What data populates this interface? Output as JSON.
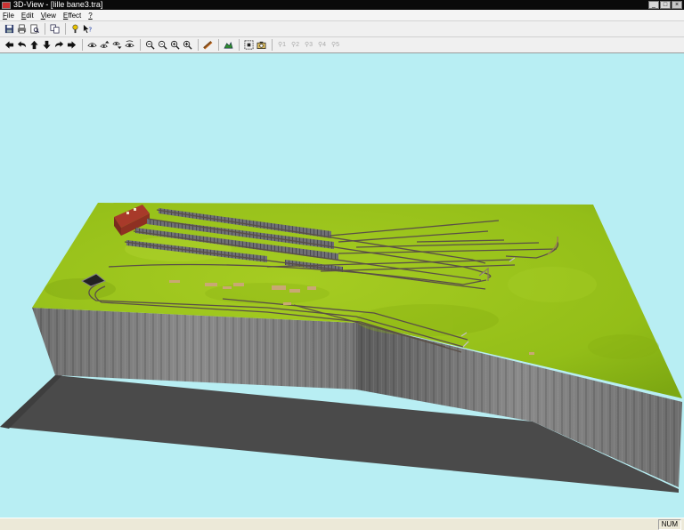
{
  "window": {
    "title": "3D-View - [lille bane3.tra]",
    "controls": {
      "minimize": "_",
      "maximize": "□",
      "close": "×"
    }
  },
  "menu": [
    {
      "label": "File",
      "key": "F"
    },
    {
      "label": "Edit",
      "key": "E"
    },
    {
      "label": "View",
      "key": "V"
    },
    {
      "label": "Effect",
      "key": "E"
    },
    {
      "label": "?",
      "key": "?"
    }
  ],
  "toolbar1": [
    {
      "icon": "save-icon"
    },
    {
      "icon": "print-icon"
    },
    {
      "icon": "print-preview-icon"
    },
    {
      "icon": "copy-icon"
    },
    {
      "icon": "help-icon"
    },
    {
      "icon": "context-help-icon"
    }
  ],
  "toolbar2": [
    {
      "icon": "arrow-left-icon"
    },
    {
      "icon": "undo-arrow-icon"
    },
    {
      "icon": "arrow-up-icon"
    },
    {
      "icon": "arrow-down-icon"
    },
    {
      "icon": "redo-arrow-icon"
    },
    {
      "icon": "arrow-right-icon"
    },
    {
      "icon": "eye-icon"
    },
    {
      "icon": "eye-up-icon"
    },
    {
      "icon": "eye-down-icon"
    },
    {
      "icon": "eye-turn-icon"
    },
    {
      "icon": "zoom-minus-icon"
    },
    {
      "icon": "zoom-out-icon"
    },
    {
      "icon": "zoom-in-icon"
    },
    {
      "icon": "zoom-plus-icon"
    },
    {
      "icon": "train-icon"
    },
    {
      "icon": "landscape-icon"
    },
    {
      "icon": "fit-view-icon"
    },
    {
      "icon": "camera-icon"
    },
    {
      "icon": "viewpoint-1-icon",
      "label": "1"
    },
    {
      "icon": "viewpoint-2-icon",
      "label": "2"
    },
    {
      "icon": "viewpoint-3-icon",
      "label": "3"
    },
    {
      "icon": "viewpoint-4-icon",
      "label": "4"
    },
    {
      "icon": "viewpoint-5-icon",
      "label": "5"
    }
  ],
  "status": {
    "num": "NUM"
  },
  "colors": {
    "sky": "#b8eef3",
    "grass": "#9ac41a",
    "cliff": "#808080",
    "shadow": "#4a4a4a",
    "track": "#5a4f47"
  }
}
